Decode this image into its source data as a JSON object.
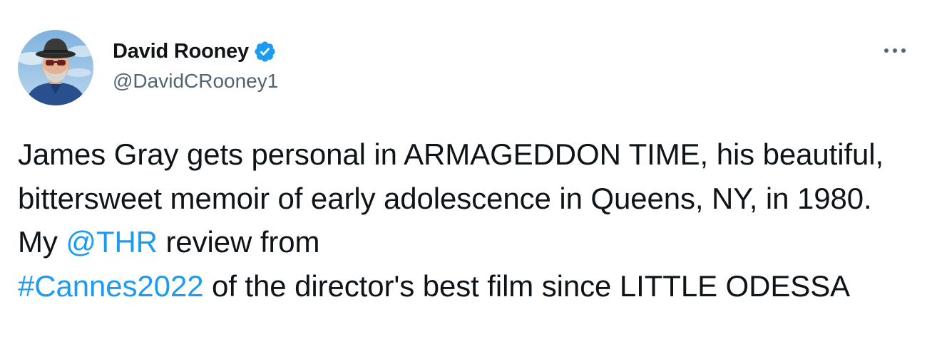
{
  "author": {
    "display_name": "David Rooney",
    "handle": "@DavidCRooney1",
    "verified": true,
    "avatar_icon": "profile-photo"
  },
  "menu": {
    "icon": "more-horizontal-icon"
  },
  "tweet": {
    "text_part1": "James Gray gets personal in ARMAGEDDON TIME, his beautiful, bittersweet memoir of early adolescence in Queens, NY, in 1980. My ",
    "mention": "@THR",
    "text_part2": " review from ",
    "hashtag": "#Cannes2022",
    "text_part3": " of the director's best film since LITTLE ODESSA"
  },
  "colors": {
    "text": "#0f1419",
    "secondary": "#536471",
    "link": "#1d9bf0",
    "verified": "#1d9bf0"
  }
}
